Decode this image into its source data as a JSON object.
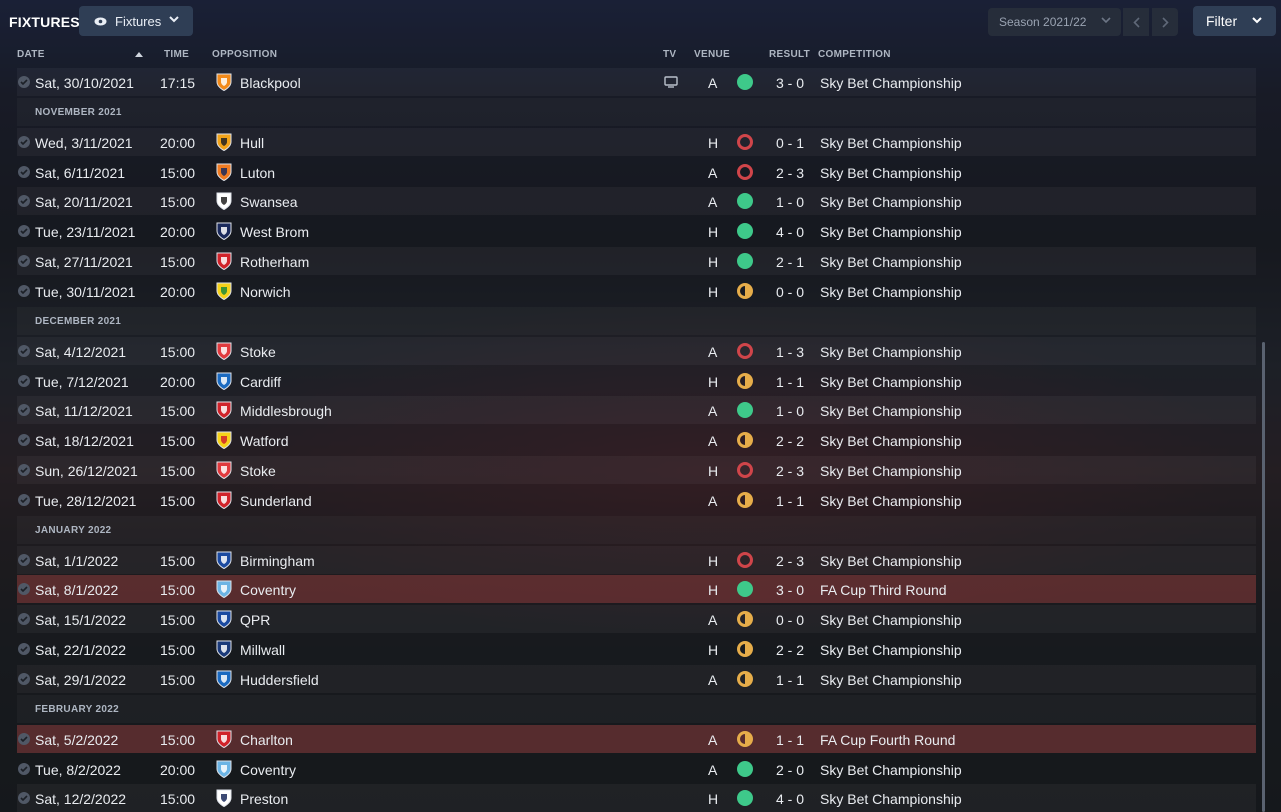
{
  "header": {
    "title": "FIXTURES",
    "view_label": "Fixtures",
    "season_label": "Season 2021/22",
    "filter_label": "Filter"
  },
  "columns": {
    "date": "DATE",
    "time": "TIME",
    "opposition": "OPPOSITION",
    "tv": "TV",
    "venue": "VENUE",
    "result": "RESULT",
    "competition": "COMPETITION"
  },
  "colors": {
    "win": "#3ec98a",
    "loss": "#d0454a",
    "draw": "#e6ad4a",
    "cup_row": "#8c3c3c"
  },
  "months": {
    "nov": "NOVEMBER 2021",
    "dec": "DECEMBER 2021",
    "jan": "JANUARY 2022",
    "feb": "FEBRUARY 2022"
  },
  "rows": [
    {
      "date": "Sat, 30/10/2021",
      "time": "17:15",
      "opp": "Blackpool",
      "tv": "tv-icon",
      "venue": "A",
      "result": "win",
      "score": "3 - 0",
      "comp": "Sky Bet Championship"
    },
    {
      "date": "Wed, 3/11/2021",
      "time": "20:00",
      "opp": "Hull",
      "venue": "H",
      "result": "loss",
      "score": "0 - 1",
      "comp": "Sky Bet Championship"
    },
    {
      "date": "Sat, 6/11/2021",
      "time": "15:00",
      "opp": "Luton",
      "venue": "A",
      "result": "loss",
      "score": "2 - 3",
      "comp": "Sky Bet Championship"
    },
    {
      "date": "Sat, 20/11/2021",
      "time": "15:00",
      "opp": "Swansea",
      "venue": "A",
      "result": "win",
      "score": "1 - 0",
      "comp": "Sky Bet Championship"
    },
    {
      "date": "Tue, 23/11/2021",
      "time": "20:00",
      "opp": "West Brom",
      "venue": "H",
      "result": "win",
      "score": "4 - 0",
      "comp": "Sky Bet Championship"
    },
    {
      "date": "Sat, 27/11/2021",
      "time": "15:00",
      "opp": "Rotherham",
      "venue": "H",
      "result": "win",
      "score": "2 - 1",
      "comp": "Sky Bet Championship"
    },
    {
      "date": "Tue, 30/11/2021",
      "time": "20:00",
      "opp": "Norwich",
      "venue": "H",
      "result": "draw",
      "score": "0 - 0",
      "comp": "Sky Bet Championship"
    },
    {
      "date": "Sat, 4/12/2021",
      "time": "15:00",
      "opp": "Stoke",
      "venue": "A",
      "result": "loss",
      "score": "1 - 3",
      "comp": "Sky Bet Championship"
    },
    {
      "date": "Tue, 7/12/2021",
      "time": "20:00",
      "opp": "Cardiff",
      "venue": "H",
      "result": "draw",
      "score": "1 - 1",
      "comp": "Sky Bet Championship"
    },
    {
      "date": "Sat, 11/12/2021",
      "time": "15:00",
      "opp": "Middlesbrough",
      "venue": "A",
      "result": "win",
      "score": "1 - 0",
      "comp": "Sky Bet Championship"
    },
    {
      "date": "Sat, 18/12/2021",
      "time": "15:00",
      "opp": "Watford",
      "venue": "A",
      "result": "draw",
      "score": "2 - 2",
      "comp": "Sky Bet Championship"
    },
    {
      "date": "Sun, 26/12/2021",
      "time": "15:00",
      "opp": "Stoke",
      "venue": "H",
      "result": "loss",
      "score": "2 - 3",
      "comp": "Sky Bet Championship"
    },
    {
      "date": "Tue, 28/12/2021",
      "time": "15:00",
      "opp": "Sunderland",
      "venue": "A",
      "result": "draw",
      "score": "1 - 1",
      "comp": "Sky Bet Championship"
    },
    {
      "date": "Sat, 1/1/2022",
      "time": "15:00",
      "opp": "Birmingham",
      "venue": "H",
      "result": "loss",
      "score": "2 - 3",
      "comp": "Sky Bet Championship"
    },
    {
      "date": "Sat, 8/1/2022",
      "time": "15:00",
      "opp": "Coventry",
      "venue": "H",
      "result": "win",
      "score": "3 - 0",
      "comp": "FA Cup Third Round"
    },
    {
      "date": "Sat, 15/1/2022",
      "time": "15:00",
      "opp": "QPR",
      "venue": "A",
      "result": "draw",
      "score": "0 - 0",
      "comp": "Sky Bet Championship"
    },
    {
      "date": "Sat, 22/1/2022",
      "time": "15:00",
      "opp": "Millwall",
      "venue": "H",
      "result": "draw",
      "score": "2 - 2",
      "comp": "Sky Bet Championship"
    },
    {
      "date": "Sat, 29/1/2022",
      "time": "15:00",
      "opp": "Huddersfield",
      "venue": "A",
      "result": "draw",
      "score": "1 - 1",
      "comp": "Sky Bet Championship"
    },
    {
      "date": "Sat, 5/2/2022",
      "time": "15:00",
      "opp": "Charlton",
      "venue": "A",
      "result": "draw",
      "score": "1 - 1",
      "comp": "FA Cup Fourth Round"
    },
    {
      "date": "Tue, 8/2/2022",
      "time": "20:00",
      "opp": "Coventry",
      "venue": "A",
      "result": "win",
      "score": "2 - 0",
      "comp": "Sky Bet Championship"
    },
    {
      "date": "Sat, 12/2/2022",
      "time": "15:00",
      "opp": "Preston",
      "venue": "H",
      "result": "win",
      "score": "4 - 0",
      "comp": "Sky Bet Championship"
    }
  ]
}
